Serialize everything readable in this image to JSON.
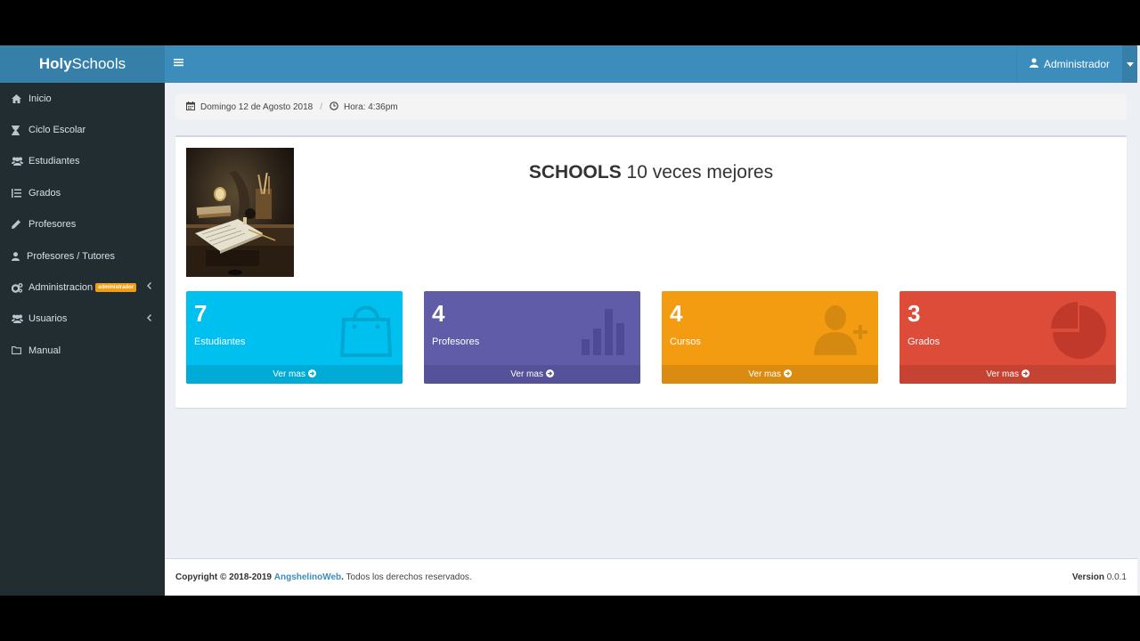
{
  "app": {
    "logo_bold": "Holy",
    "logo_rest": "Schools"
  },
  "header": {
    "user_label": "Administrador"
  },
  "sidebar": {
    "items": [
      {
        "label": "Inicio"
      },
      {
        "label": "Ciclo Escolar"
      },
      {
        "label": "Estudiantes"
      },
      {
        "label": "Grados"
      },
      {
        "label": "Profesores"
      },
      {
        "label": "Profesores / Tutores"
      },
      {
        "label": "Administracion",
        "badge": "administrador"
      },
      {
        "label": "Usuarios"
      },
      {
        "label": "Manual"
      }
    ]
  },
  "breadcrumb": {
    "date": "Domingo 12 de Agosto 2018",
    "separator": "/",
    "time": "Hora: 4:36pm"
  },
  "main": {
    "headline_strong": "SCHOOLS",
    "headline_rest": " 10 veces mejores"
  },
  "cards": [
    {
      "value": "7",
      "label": "Estudiantes",
      "link": "Ver mas",
      "color": "#00c0ef",
      "foot_color": "#00acd6",
      "icon_color": "#00a7d0"
    },
    {
      "value": "4",
      "label": "Profesores",
      "link": "Ver mas",
      "color": "#605ca8",
      "foot_color": "#555299",
      "icon_color": "#4e4a96"
    },
    {
      "value": "4",
      "label": "Cursos",
      "link": "Ver mas",
      "color": "#f39c12",
      "foot_color": "#da8c10",
      "icon_color": "#d68910"
    },
    {
      "value": "3",
      "label": "Grados",
      "link": "Ver mas",
      "color": "#dd4b39",
      "foot_color": "#c64333",
      "icon_color": "#c0392b"
    }
  ],
  "footer": {
    "copyright": "Copyright © 2018-2019",
    "brand": "AngshelinoWeb",
    "rights": " Todos los derechos reservados.",
    "version_label": "Version",
    "version_value": "0.0.1"
  },
  "icons": [
    "bars-icon",
    "user-icon",
    "caret-down-icon",
    "home-icon",
    "hourglass-icon",
    "users-icon",
    "list-icon",
    "pencil-icon",
    "cogs-icon",
    "folder-icon",
    "angle-left-icon",
    "calendar-icon",
    "clock-icon",
    "shopping-bag-icon",
    "bar-chart-icon",
    "user-plus-icon",
    "pie-chart-icon",
    "arrow-circle-right-icon"
  ]
}
